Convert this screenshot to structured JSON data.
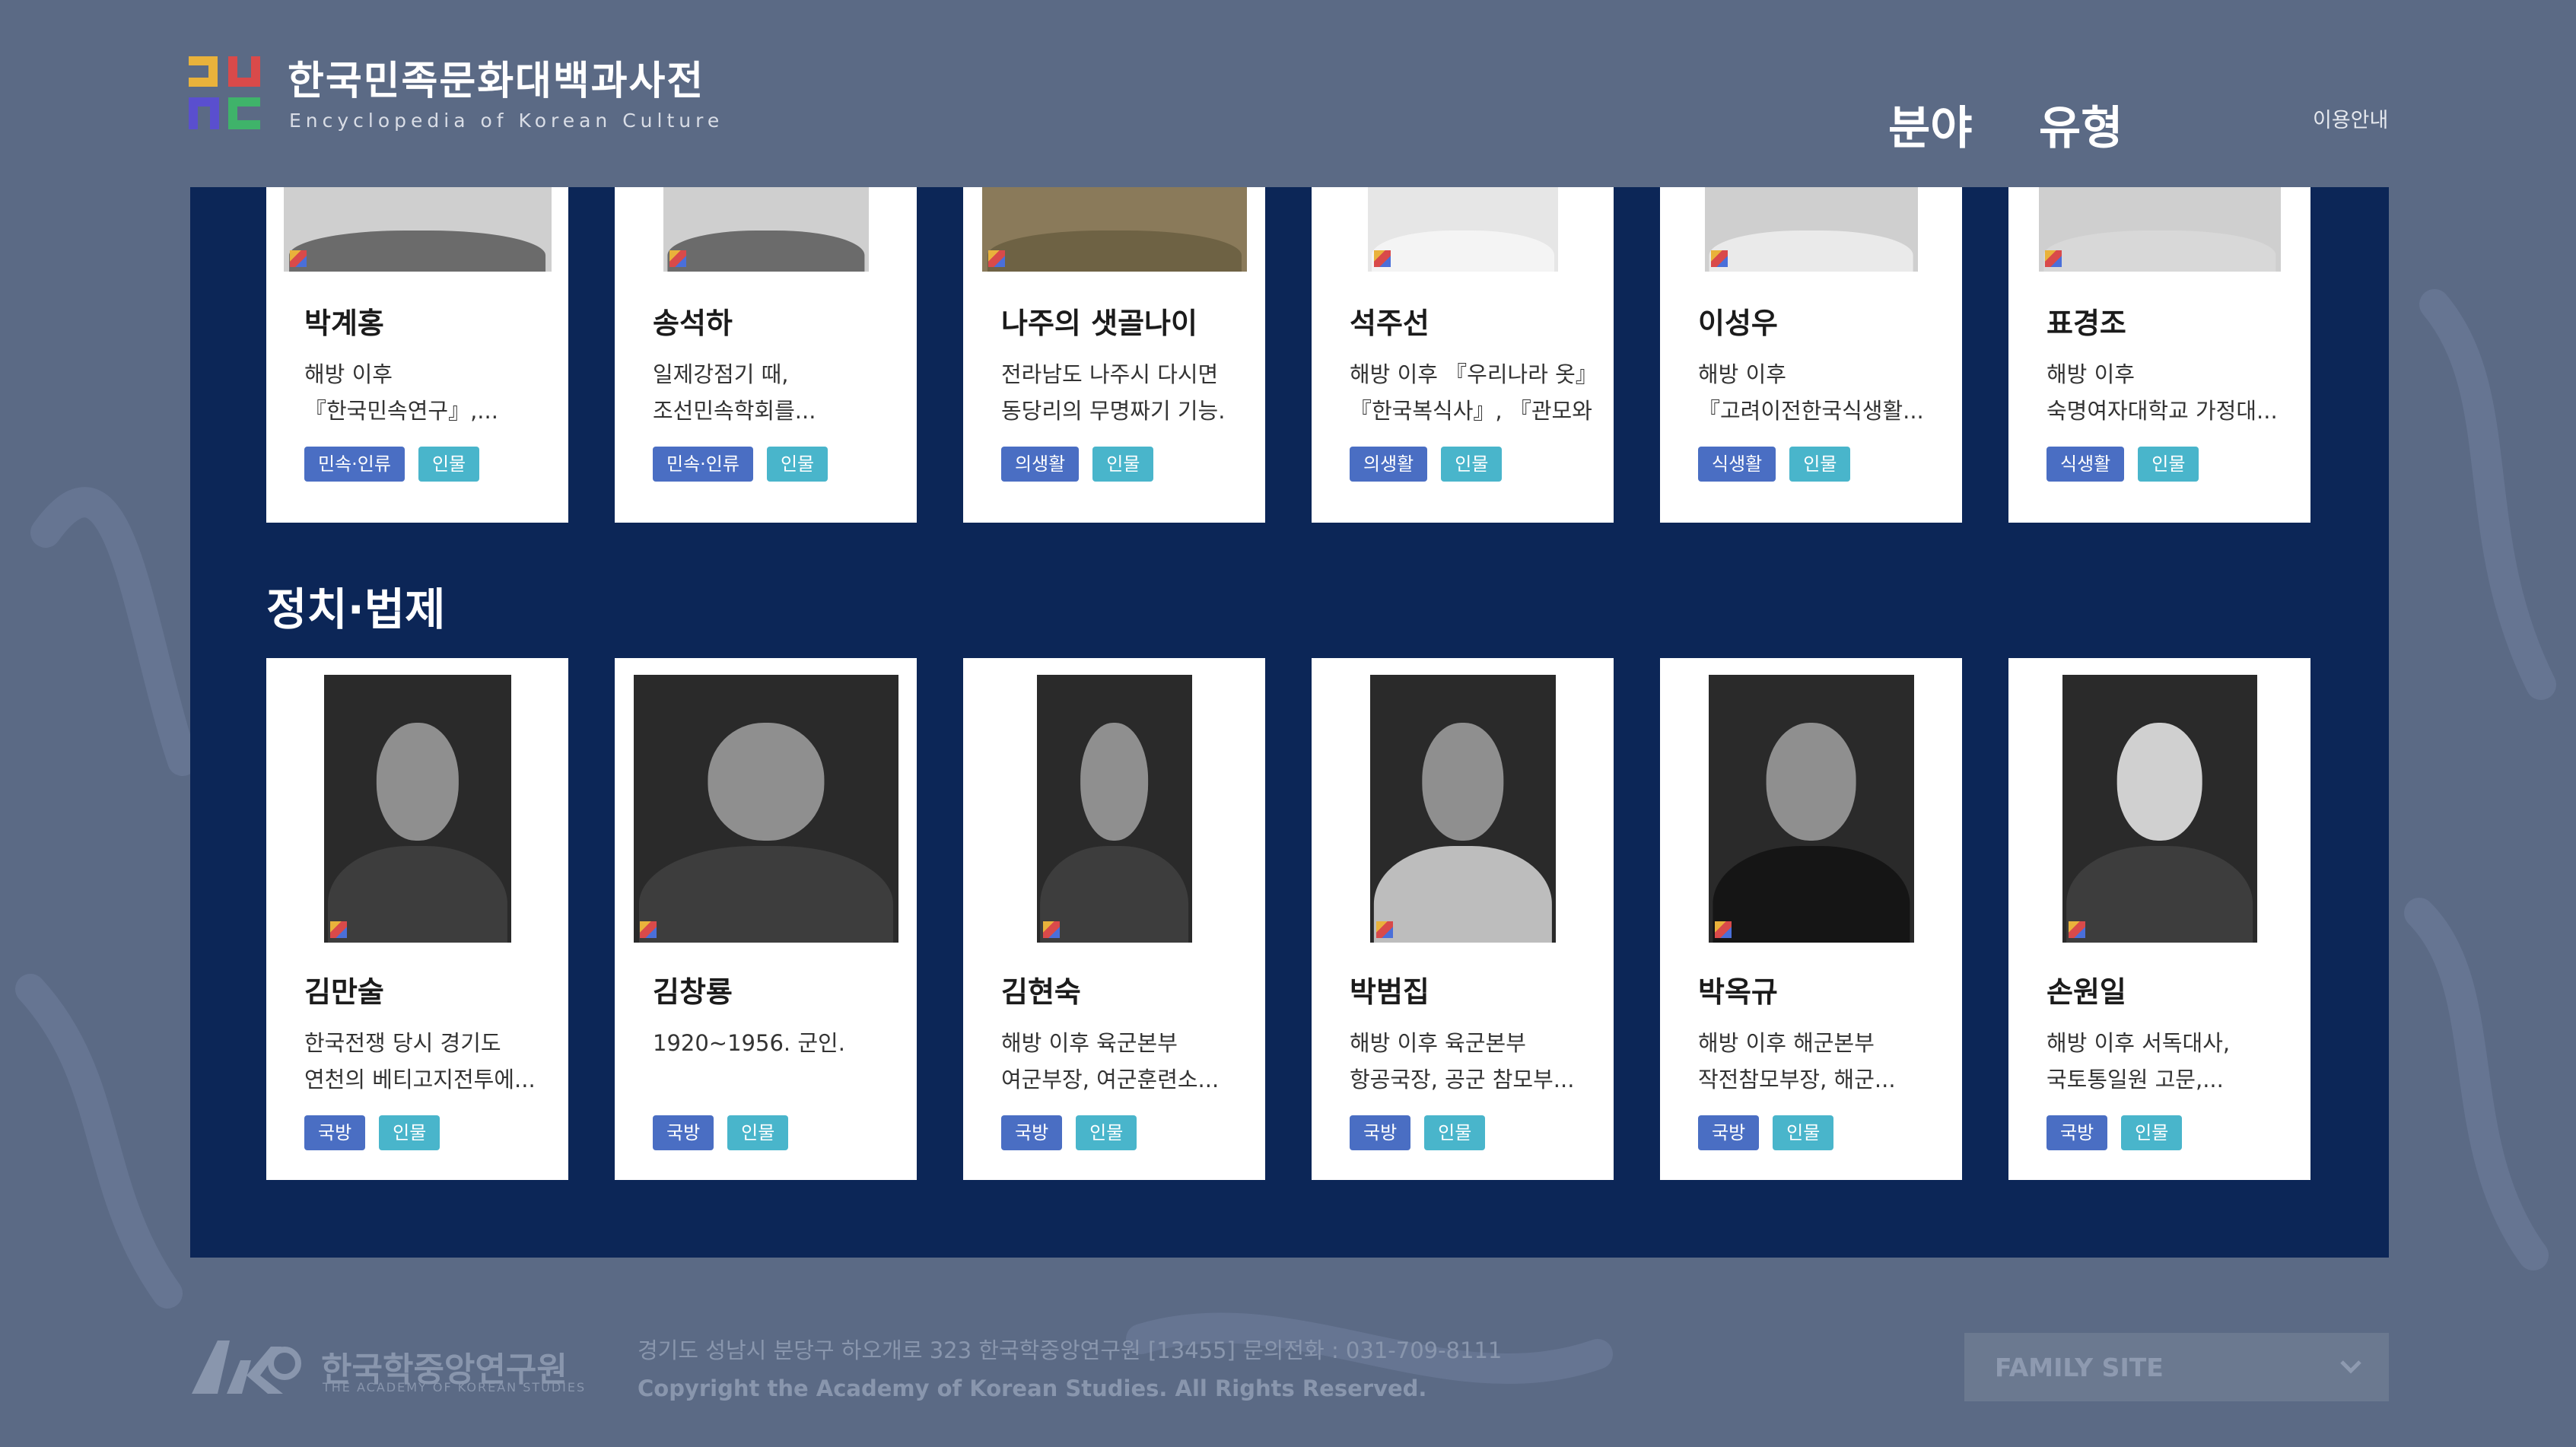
{
  "header": {
    "title": "한국민족문화대백과사전",
    "subtitle": "Encyclopedia of Korean Culture",
    "nav": [
      "분야",
      "유형"
    ],
    "help": "이용안내"
  },
  "cards_top": [
    {
      "name": "박계홍",
      "desc": [
        "해방 이후",
        "『한국민속연구』,..."
      ],
      "tags": [
        "민속·인류",
        "인물"
      ]
    },
    {
      "name": "송석하",
      "desc": [
        "일제강점기 때,",
        "조선민속학회를..."
      ],
      "tags": [
        "민속·인류",
        "인물"
      ]
    },
    {
      "name": "나주의 샛골나이",
      "desc": [
        "전라남도 나주시 다시면",
        "동당리의 무명짜기 기능."
      ],
      "tags": [
        "의생활",
        "인물"
      ]
    },
    {
      "name": "석주선",
      "desc": [
        "해방 이후 『우리나라 옷』,",
        "『한국복식사』, 『관모와..."
      ],
      "tags": [
        "의생활",
        "인물"
      ]
    },
    {
      "name": "이성우",
      "desc": [
        "해방 이후",
        "『고려이전한국식생활..."
      ],
      "tags": [
        "식생활",
        "인물"
      ]
    },
    {
      "name": "표경조",
      "desc": [
        "해방 이후",
        "숙명여자대학교 가정대..."
      ],
      "tags": [
        "식생활",
        "인물"
      ]
    }
  ],
  "section": {
    "title": "정치·법제"
  },
  "cards_bottom": [
    {
      "name": "김만술",
      "desc": [
        "한국전쟁 당시 경기도",
        "연천의 베티고지전투에..."
      ],
      "tags": [
        "국방",
        "인물"
      ]
    },
    {
      "name": "김창룡",
      "desc": [
        "1920~1956. 군인.",
        ""
      ],
      "tags": [
        "국방",
        "인물"
      ]
    },
    {
      "name": "김현숙",
      "desc": [
        "해방 이후 육군본부",
        "여군부장, 여군훈련소..."
      ],
      "tags": [
        "국방",
        "인물"
      ]
    },
    {
      "name": "박범집",
      "desc": [
        "해방 이후 육군본부",
        "항공국장, 공군 참모부..."
      ],
      "tags": [
        "국방",
        "인물"
      ]
    },
    {
      "name": "박옥규",
      "desc": [
        "해방 이후 해군본부",
        "작전참모부장, 해군..."
      ],
      "tags": [
        "국방",
        "인물"
      ]
    },
    {
      "name": "손원일",
      "desc": [
        "해방 이후 서독대사,",
        "국토통일원 고문,..."
      ],
      "tags": [
        "국방",
        "인물"
      ]
    }
  ],
  "footer": {
    "org_name": "한국학중앙연구원",
    "org_en": "THE ACADEMY OF KOREAN STUDIES",
    "address": "경기도 성남시 분당구 하오개로 323 한국학중앙연구원 [13455]",
    "phone": "문의전화 : 031-709-8111",
    "copyright": "Copyright the Academy of Korean Studies. All Rights Reserved.",
    "family_site": "FAMILY SITE"
  },
  "colors": {
    "backdrop": "#5b6a85",
    "panel": "#0c2657",
    "tag_field": "#4a6ec3",
    "tag_type": "#49b5cb"
  },
  "icons": [
    "site-logo-icon",
    "akc-logo-icon",
    "chevron-down-icon"
  ]
}
